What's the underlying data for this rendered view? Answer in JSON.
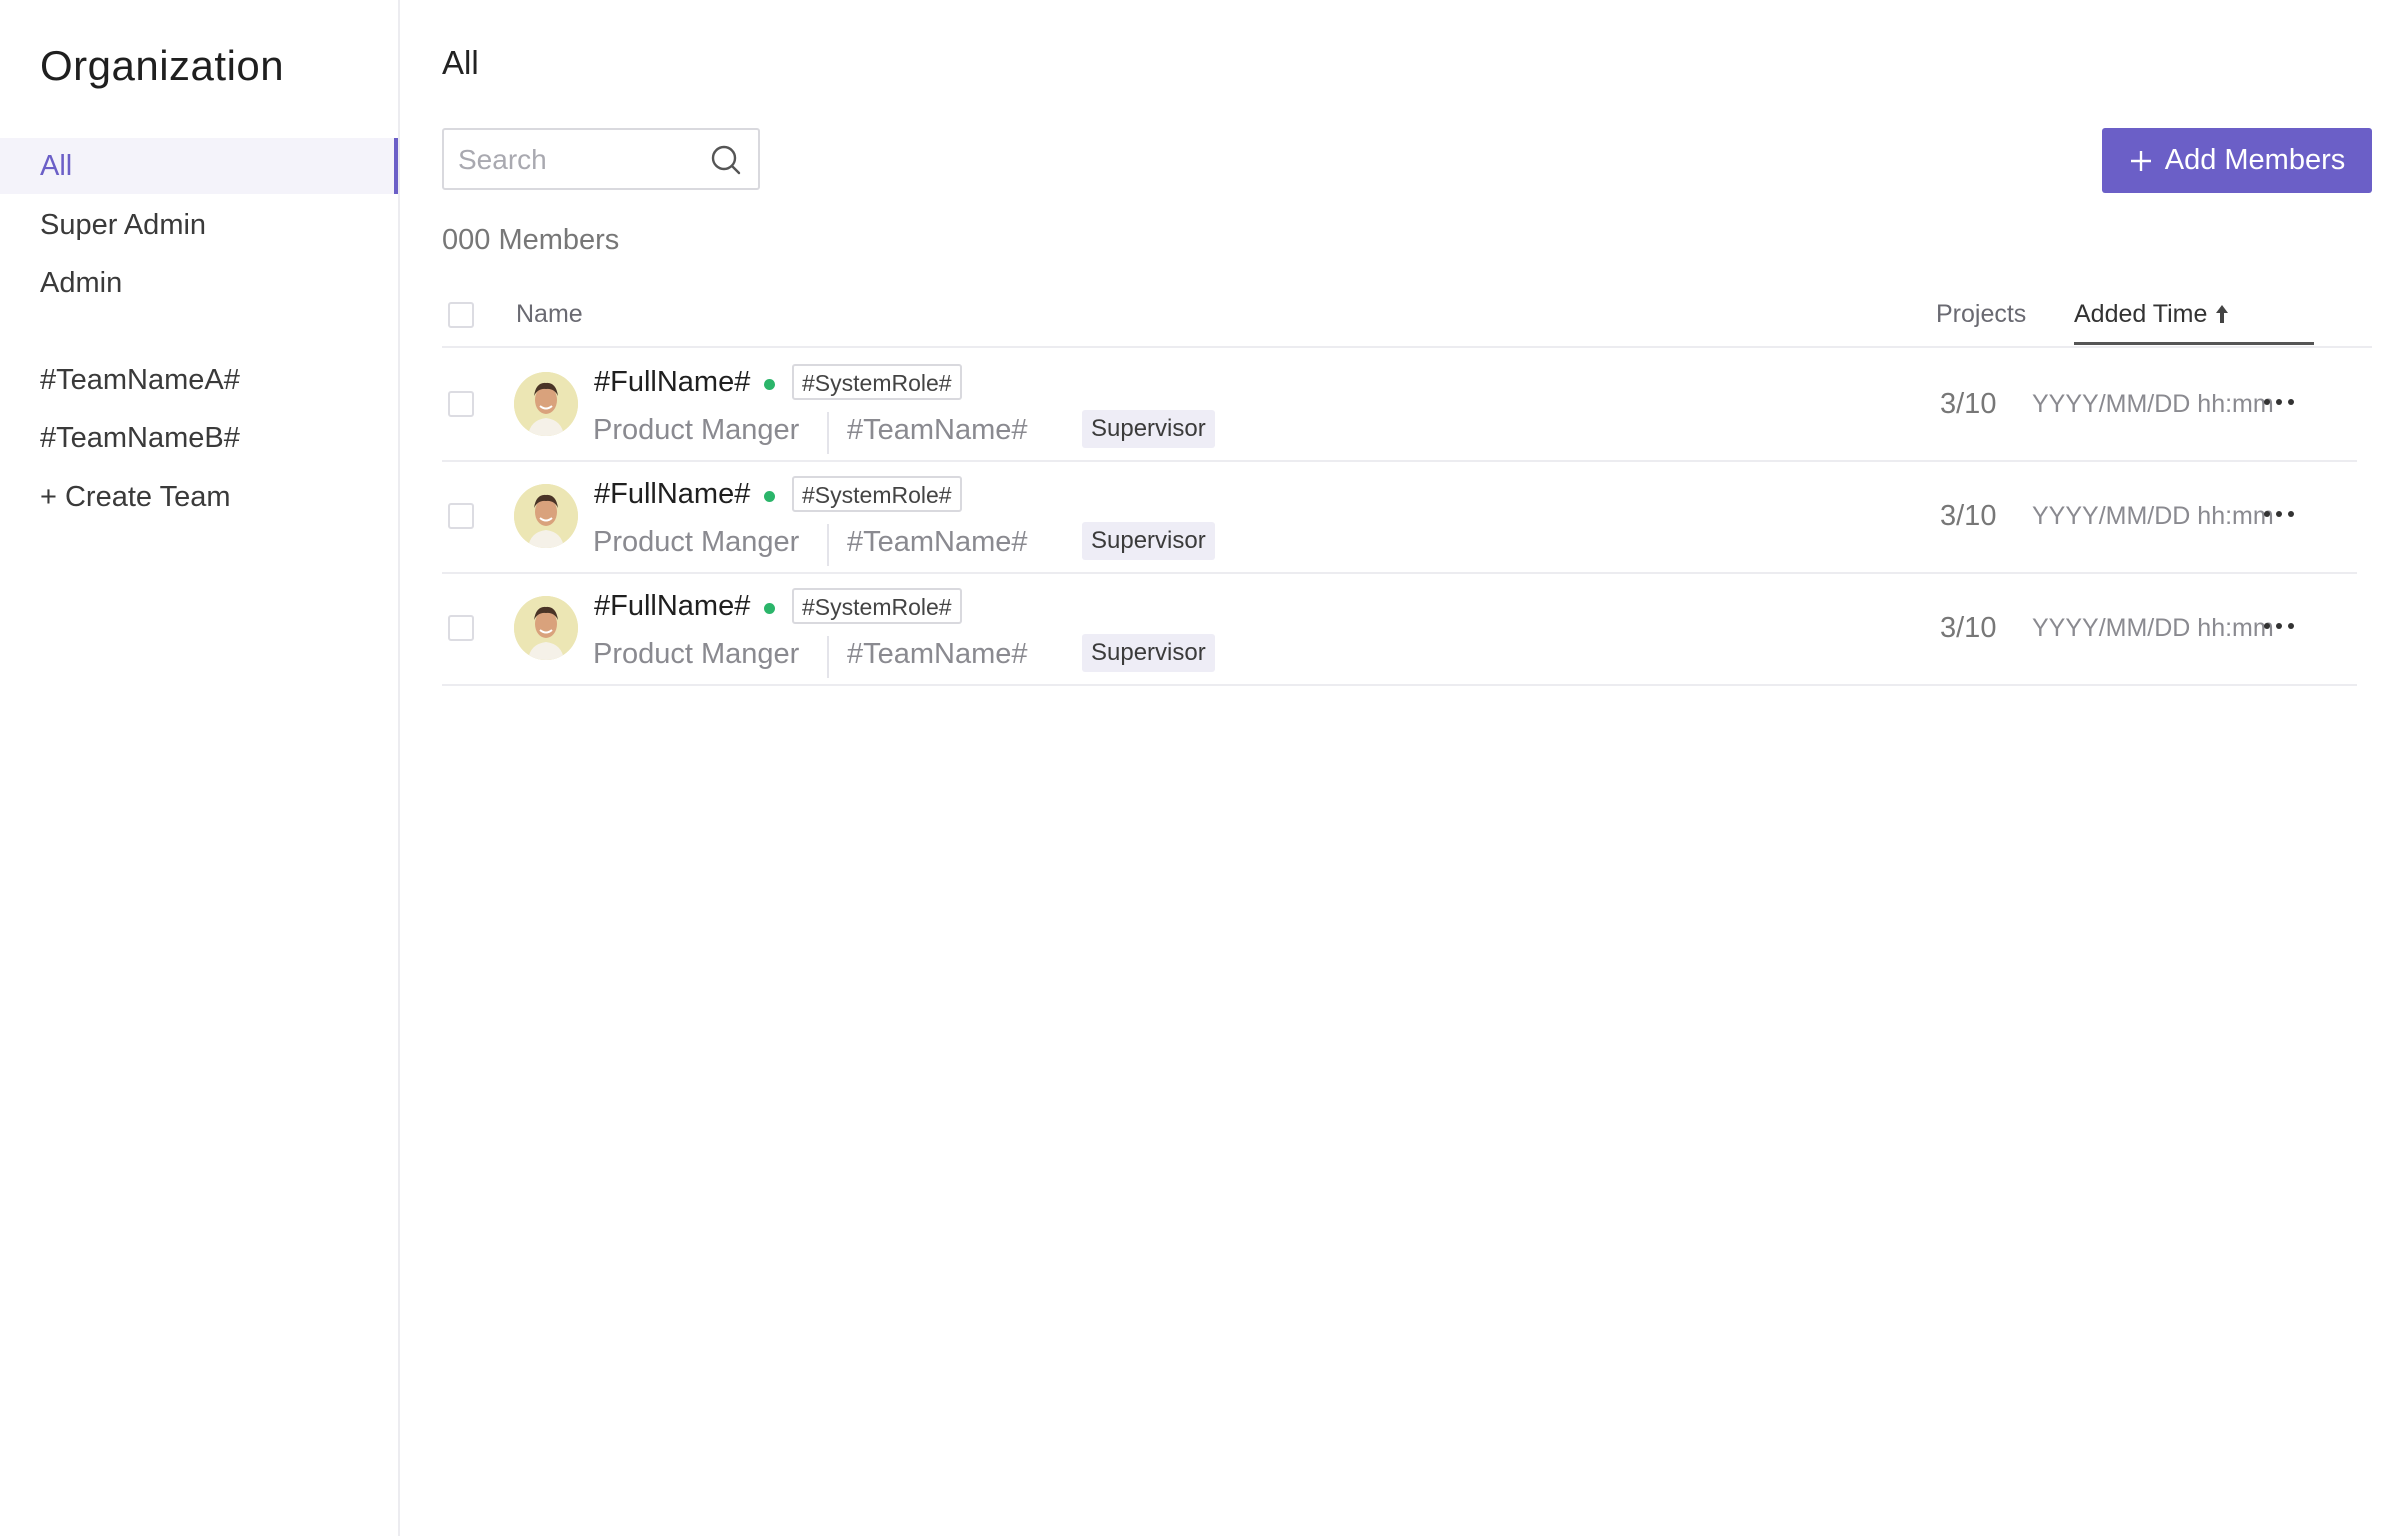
{
  "sidebar": {
    "title": "Organization",
    "items": [
      {
        "label": "All"
      },
      {
        "label": "Super Admin"
      },
      {
        "label": "Admin"
      },
      {
        "label": "#TeamNameA#"
      },
      {
        "label": "#TeamNameB#"
      },
      {
        "label": "+ Create Team"
      }
    ],
    "active_item": "All",
    "accent_color": "#6b5fc7"
  },
  "main": {
    "title": "All",
    "search": {
      "placeholder": "Search",
      "value": "",
      "icon": "search-icon"
    },
    "add_button": {
      "label": "Add Members",
      "icon": "plus-icon"
    },
    "member_count": "000 Members"
  },
  "table": {
    "columns": {
      "name": "Name",
      "projects": "Projects",
      "added_time": "Added Time"
    },
    "sort": {
      "column": "Added Time",
      "direction": "ascending",
      "icon": "arrow-up-icon"
    },
    "rows": [
      {
        "full_name": "#FullName#",
        "status": "online",
        "system_role": "#SystemRole#",
        "job_title": "Product Manger",
        "team_name": "#TeamName#",
        "team_role": "Supervisor",
        "projects": "3/10",
        "added_time": "YYYY/MM/DD hh:mm"
      },
      {
        "full_name": "#FullName#",
        "status": "online",
        "system_role": "#SystemRole#",
        "job_title": "Product Manger",
        "team_name": "#TeamName#",
        "team_role": "Supervisor",
        "projects": "3/10",
        "added_time": "YYYY/MM/DD hh:mm"
      },
      {
        "full_name": "#FullName#",
        "status": "online",
        "system_role": "#SystemRole#",
        "job_title": "Product Manger",
        "team_name": "#TeamName#",
        "team_role": "Supervisor",
        "projects": "3/10",
        "added_time": "YYYY/MM/DD hh:mm"
      }
    ]
  },
  "colors": {
    "accent": "#6b5fc7",
    "online": "#2bb56a",
    "tag_bg": "#eeedf6"
  }
}
